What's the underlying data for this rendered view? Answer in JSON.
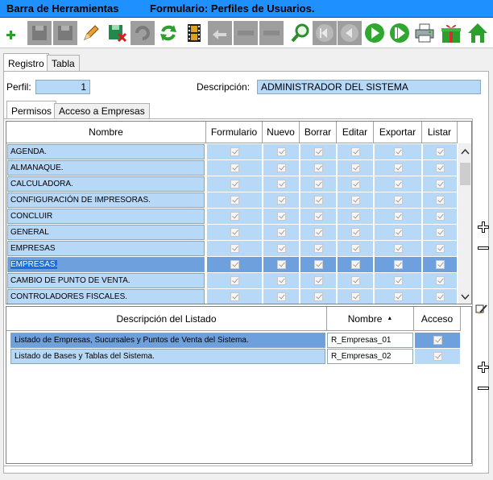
{
  "titlebar": {
    "app": "Barra de Herramientas",
    "form": "Formulario: Perfiles de Usuarios."
  },
  "toolbar": {
    "buttons": [
      {
        "icon": "add-icon",
        "enabled": true
      },
      {
        "icon": "save-icon",
        "enabled": false
      },
      {
        "icon": "save-as-icon",
        "enabled": false
      },
      {
        "icon": "edit-pencil-icon",
        "enabled": true
      },
      {
        "icon": "save-close-icon",
        "enabled": true
      },
      {
        "icon": "undo-icon",
        "enabled": false
      },
      {
        "icon": "refresh-icon",
        "enabled": true
      },
      {
        "icon": "film-icon",
        "enabled": true
      },
      {
        "icon": "return-icon",
        "enabled": false
      },
      {
        "icon": "blank-icon",
        "enabled": false
      },
      {
        "icon": "blank-icon",
        "enabled": false
      },
      {
        "icon": "search-icon",
        "enabled": true
      },
      {
        "icon": "first-record-icon",
        "enabled": false
      },
      {
        "icon": "previous-record-icon",
        "enabled": false
      },
      {
        "icon": "next-record-icon",
        "enabled": true
      },
      {
        "icon": "last-record-icon",
        "enabled": true
      },
      {
        "icon": "printer-icon",
        "enabled": true
      },
      {
        "icon": "gift-icon",
        "enabled": true
      },
      {
        "icon": "home-icon",
        "enabled": true
      }
    ]
  },
  "tabs": {
    "registro": "Registro",
    "tabla": "Tabla"
  },
  "perfil": {
    "label": "Perfil:",
    "value": "1"
  },
  "descripcion": {
    "label": "Descripción:",
    "value": "ADMINISTRADOR DEL SISTEMA"
  },
  "subtabs": {
    "permisos": "Permisos",
    "acceso": "Acceso a Empresas"
  },
  "permisos_grid": {
    "headers": [
      "Nombre",
      "Formulario",
      "Nuevo",
      "Borrar",
      "Editar",
      "Exportar",
      "Listar"
    ],
    "rows": [
      {
        "nombre": "AGENDA.",
        "selected": false
      },
      {
        "nombre": "ALMANAQUE.",
        "selected": false
      },
      {
        "nombre": "CALCULADORA.",
        "selected": false
      },
      {
        "nombre": "CONFIGURACIÓN DE IMPRESORAS.",
        "selected": false
      },
      {
        "nombre": "CONCLUIR",
        "selected": false
      },
      {
        "nombre": "GENERAL",
        "selected": false
      },
      {
        "nombre": "EMPRESAS",
        "selected": false
      },
      {
        "nombre": "EMPRESAS.",
        "selected": true
      },
      {
        "nombre": "CAMBIO DE PUNTO DE VENTA.",
        "selected": false
      },
      {
        "nombre": "CONTROLADORES FISCALES.",
        "selected": false
      }
    ]
  },
  "listados_grid": {
    "headers": [
      "Descripción del Listado",
      "Nombre",
      "Acceso"
    ],
    "sort_indicator": "▲",
    "rows": [
      {
        "descripcion": "Listado de Empresas, Sucursales y Puntos de Venta del Sistema.",
        "nombre": "R_Empresas_01",
        "selected": true
      },
      {
        "descripcion": "Listado de Bases y Tablas del Sistema.",
        "nombre": "R_Empresas_02",
        "selected": false
      }
    ]
  }
}
